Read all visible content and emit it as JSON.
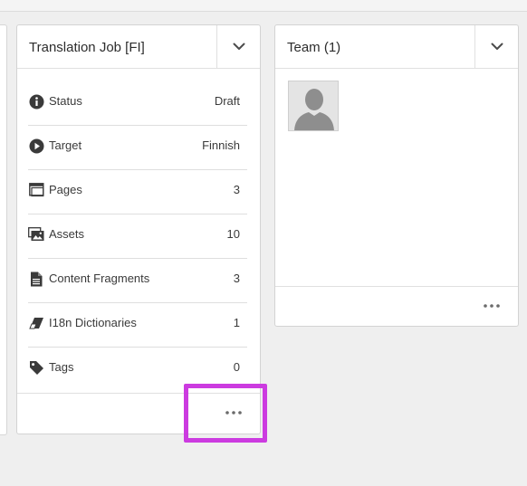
{
  "translation_card": {
    "title": "Translation Job [FI]",
    "rows": [
      {
        "icon": "info-icon",
        "label": "Status",
        "value": "Draft"
      },
      {
        "icon": "play-circle-icon",
        "label": "Target",
        "value": "Finnish"
      },
      {
        "icon": "pages-icon",
        "label": "Pages",
        "value": "3"
      },
      {
        "icon": "assets-icon",
        "label": "Assets",
        "value": "10"
      },
      {
        "icon": "document-icon",
        "label": "Content Fragments",
        "value": "3"
      },
      {
        "icon": "eraser-icon",
        "label": "I18n Dictionaries",
        "value": "1"
      },
      {
        "icon": "tag-icon",
        "label": "Tags",
        "value": "0"
      }
    ],
    "more_label": "•••"
  },
  "team_card": {
    "title": "Team (1)",
    "more_label": "•••"
  },
  "colors": {
    "highlight": "#cc3be0",
    "icon": "#3a3a3a",
    "border": "#d3d3d3"
  }
}
